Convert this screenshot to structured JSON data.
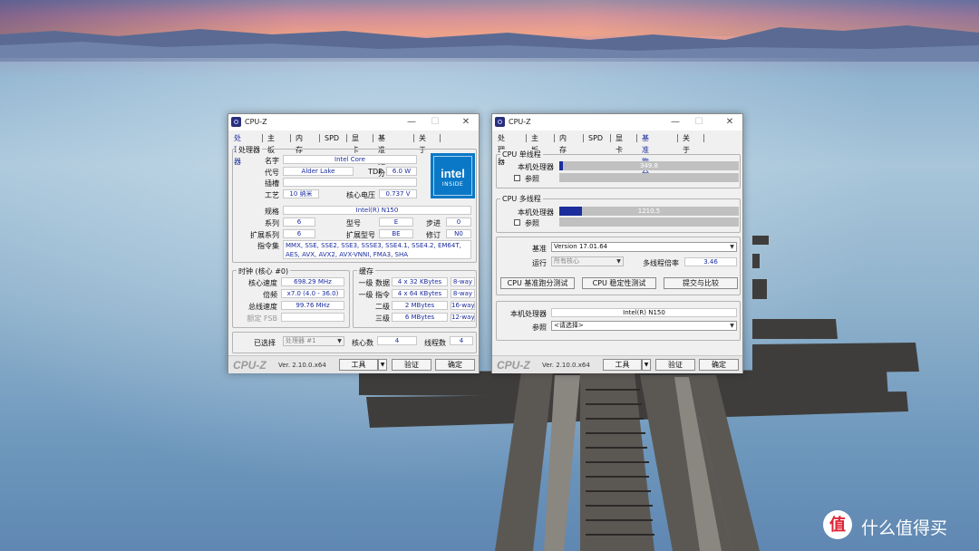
{
  "window1": {
    "title": "CPU-Z",
    "tabs": [
      "处理器",
      "主板",
      "内存",
      "SPD",
      "显卡",
      "基准跑分",
      "关于"
    ],
    "processor_group": "处理器",
    "name_label": "名字",
    "name": "Intel Core",
    "codename_label": "代号",
    "codename": "Alder Lake",
    "tdp_label": "TDP",
    "tdp": "6.0 W",
    "package_label": "插槽",
    "package": "",
    "technology_label": "工艺",
    "technology": "10 纳米",
    "voltage_label": "核心电压",
    "voltage": "0.737 V",
    "spec_label": "规格",
    "spec": "Intel(R) N150",
    "family_label": "系列",
    "family": "6",
    "model_label": "型号",
    "model": "E",
    "stepping_label": "步进",
    "stepping": "0",
    "ext_family_label": "扩展系列",
    "ext_family": "6",
    "ext_model_label": "扩展型号",
    "ext_model": "BE",
    "revision_label": "修订",
    "revision": "N0",
    "instructions_label": "指令集",
    "instructions": "MMX, SSE, SSE2, SSE3, SSSE3, SSE4.1, SSE4.2, EM64T, AES, AVX, AVX2, AVX-VNNI, FMA3, SHA",
    "logo": {
      "word": "intel",
      "inside": "INSIDE"
    },
    "clocks_group": "时钟 (核心 #0)",
    "core_speed_label": "核心速度",
    "core_speed": "698.29 MHz",
    "multiplier_label": "倍频",
    "multiplier": "x7.0 (4.0 - 36.0)",
    "bus_speed_label": "总线速度",
    "bus_speed": "99.76 MHz",
    "rated_fsb_label": "额定 FSB",
    "rated_fsb": "",
    "cache_group": "缓存",
    "l1d_label": "一级 数据",
    "l1d": "4 x 32 KBytes",
    "l1d_way": "8-way",
    "l1i_label": "一级 指令",
    "l1i": "4 x 64 KBytes",
    "l1i_way": "8-way",
    "l2_label": "二级",
    "l2": "2 MBytes",
    "l2_way": "16-way",
    "l3_label": "三级",
    "l3": "6 MBytes",
    "l3_way": "12-way",
    "selection_label": "已选择",
    "selection": "处理器 #1",
    "cores_label": "核心数",
    "cores": "4",
    "threads_label": "线程数",
    "threads": "4",
    "brand": "CPU-Z",
    "version": "Ver. 2.10.0.x64",
    "tools_button": "工具",
    "validate_button": "验证",
    "ok_button": "确定"
  },
  "window2": {
    "title": "CPU-Z",
    "tabs": [
      "处理器",
      "主板",
      "内存",
      "SPD",
      "显卡",
      "基准跑分",
      "关于"
    ],
    "single_group": "CPU 单线程",
    "this_processor_label": "本机处理器",
    "single_score": "349.8",
    "single_fill": 0.022,
    "reference_label": "参照",
    "multi_group": "CPU 多线程",
    "multi_score": "1210.5",
    "multi_fill": 0.125,
    "benchmark_label": "基准",
    "benchmark_value": "Version 17.01.64",
    "run_label": "运行",
    "run_value": "所有核心",
    "multi_ratio_label": "多线程倍率",
    "multi_ratio": "3.46",
    "bench_cpu_button": "CPU 基准跑分测试",
    "stress_cpu_button": "CPU 稳定性测试",
    "submit_button": "提交与比较",
    "this_processor_name": "Intel(R) N150",
    "reference_select": "<请选择>",
    "brand": "CPU-Z",
    "version": "Ver. 2.10.0.x64",
    "tools_button": "工具",
    "validate_button": "验证",
    "ok_button": "确定"
  },
  "watermark": {
    "logo": "值",
    "text": "什么值得买"
  }
}
